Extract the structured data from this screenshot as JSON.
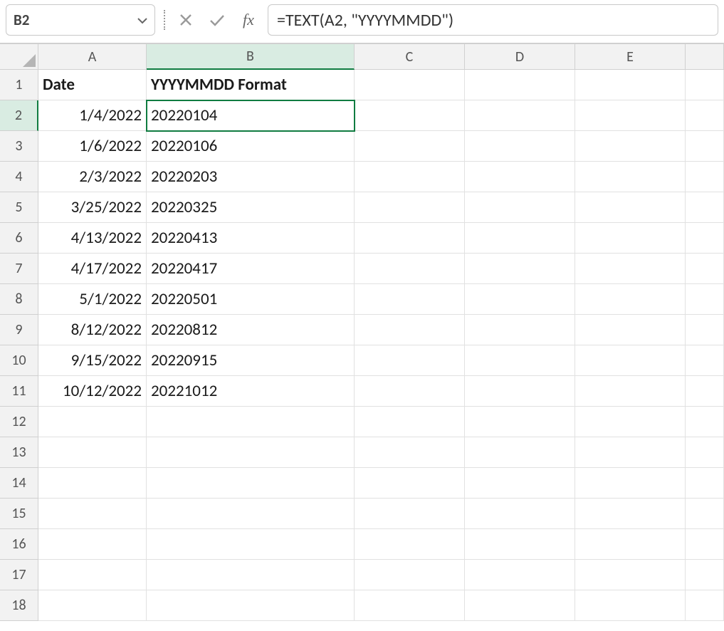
{
  "active_cell": "B2",
  "formula": "=TEXT(A2, \"YYYYMMDD\")",
  "columns": [
    "A",
    "B",
    "C",
    "D",
    "E"
  ],
  "active_col": "B",
  "active_row": 2,
  "visible_rows": 18,
  "headers": {
    "A": "Date",
    "B": "YYYYMMDD Format"
  },
  "rows": [
    {
      "date": "1/4/2022",
      "fmt": "20220104"
    },
    {
      "date": "1/6/2022",
      "fmt": "20220106"
    },
    {
      "date": "2/3/2022",
      "fmt": "20220203"
    },
    {
      "date": "3/25/2022",
      "fmt": "20220325"
    },
    {
      "date": "4/13/2022",
      "fmt": "20220413"
    },
    {
      "date": "4/17/2022",
      "fmt": "20220417"
    },
    {
      "date": "5/1/2022",
      "fmt": "20220501"
    },
    {
      "date": "8/12/2022",
      "fmt": "20220812"
    },
    {
      "date": "9/15/2022",
      "fmt": "20220915"
    },
    {
      "date": "10/12/2022",
      "fmt": "20221012"
    }
  ]
}
